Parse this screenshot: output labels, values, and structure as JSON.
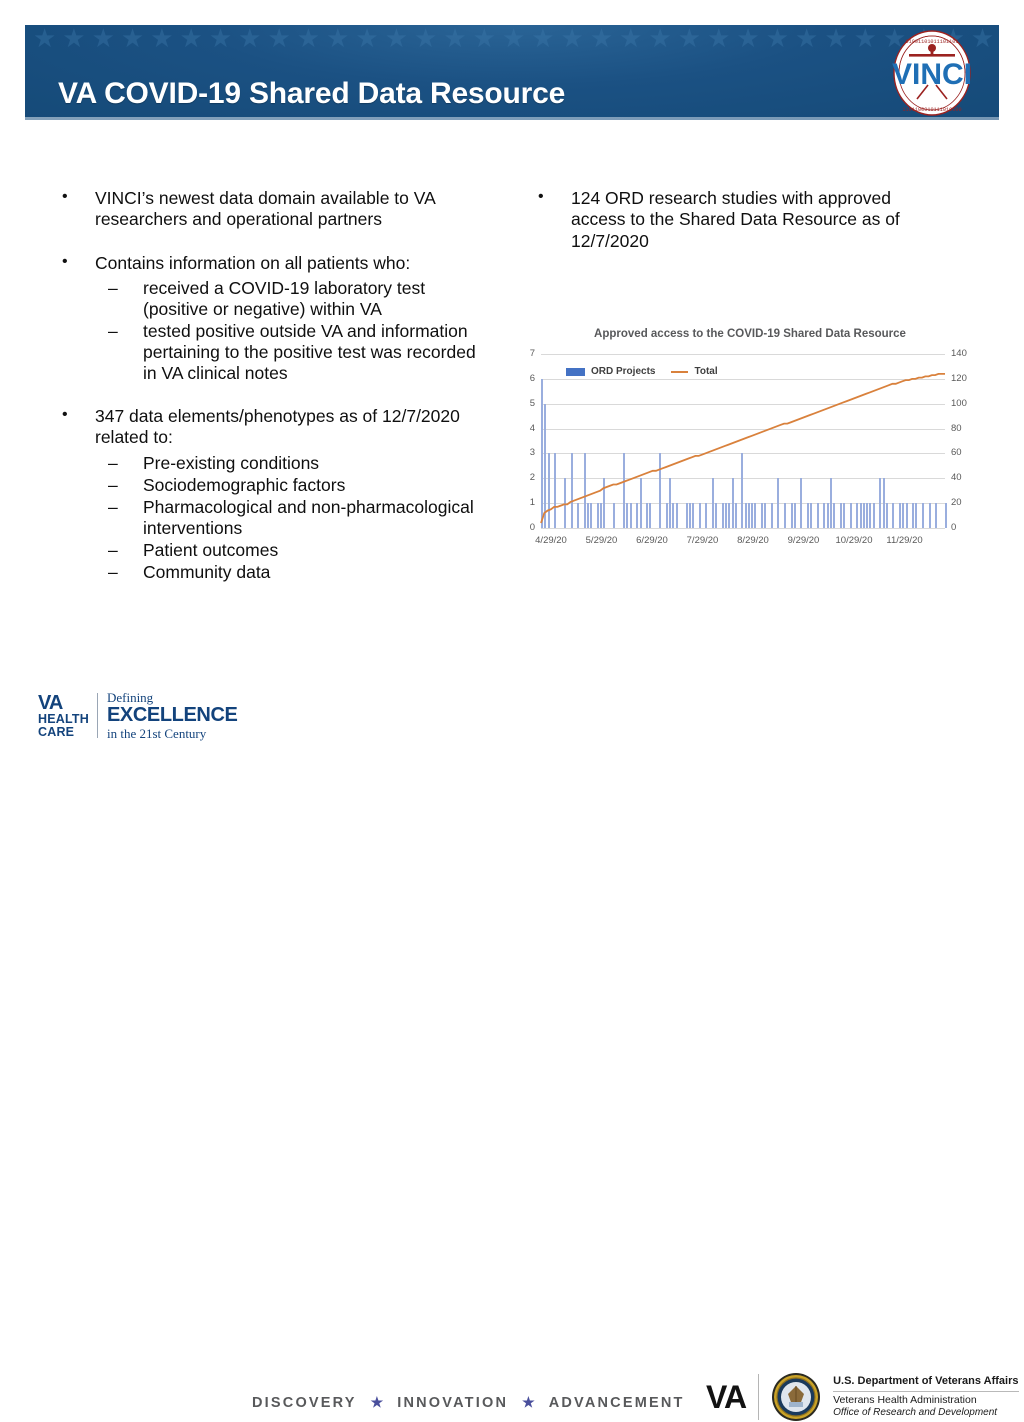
{
  "header": {
    "title": "VA COVID-19 Shared Data Resource",
    "logo_text": "VINCI",
    "logo_name": "vinci-logo",
    "banner_color": "#15507f",
    "star_glyph": "★★★★★★★★★★★★★★★★★★★★★★★★★★★★★★★★★★★★★★★★★★★★★★★★★★★★★★"
  },
  "left_column": {
    "bullets": [
      {
        "text": "VINCI’s newest data domain available to VA researchers and operational partners",
        "sub": []
      },
      {
        "text": "Contains information on all patients who:",
        "sub": [
          "received a COVID-19 laboratory test (positive or negative) within VA",
          "tested positive outside VA and information pertaining to the positive test was recorded in VA clinical notes"
        ]
      },
      {
        "text": "347 data elements/phenotypes as of 12/7/2020 related to:",
        "sub": [
          "Pre-existing conditions",
          "Sociodemographic factors",
          "Pharmacological and non-pharmacological interventions",
          "Patient outcomes",
          "Community data"
        ]
      }
    ]
  },
  "right_column": {
    "bullets": [
      {
        "text": "124 ORD research studies with approved access to the Shared Data Resource as of 12/7/2020",
        "sub": []
      }
    ]
  },
  "chart_data": {
    "type": "line",
    "title": "Approved access to the COVID-19 Shared Data Resource",
    "xlabel": "",
    "ylabel": "",
    "grid": true,
    "legend_position": "top-left",
    "bar_color": "#9aaede",
    "line_color": "#d9813c",
    "y_left": {
      "label": "ORD Projects",
      "ticks": [
        0,
        1,
        2,
        3,
        4,
        5,
        6,
        7
      ],
      "ylim": [
        0,
        7
      ]
    },
    "y_right": {
      "label": "Total",
      "ticks": [
        0,
        20,
        40,
        60,
        80,
        100,
        120,
        140
      ],
      "ylim": [
        0,
        140
      ]
    },
    "x_ticks": [
      "4/29/20",
      "5/29/20",
      "6/29/20",
      "7/29/20",
      "8/29/20",
      "9/29/20",
      "10/29/20",
      "11/29/20"
    ],
    "x_range": [
      "4/29/20",
      "12/7/20"
    ],
    "series": [
      {
        "name": "ORD Projects",
        "type": "bar",
        "axis": "left",
        "values": [
          6,
          5,
          3,
          0,
          3,
          0,
          0,
          2,
          0,
          3,
          0,
          1,
          0,
          3,
          1,
          1,
          0,
          1,
          1,
          2,
          0,
          0,
          1,
          0,
          0,
          3,
          1,
          1,
          0,
          1,
          2,
          0,
          1,
          1,
          0,
          0,
          3,
          0,
          1,
          2,
          1,
          1,
          0,
          0,
          1,
          1,
          1,
          0,
          1,
          0,
          1,
          0,
          2,
          1,
          0,
          1,
          1,
          1,
          2,
          1,
          0,
          3,
          1,
          1,
          1,
          1,
          0,
          1,
          1,
          0,
          1,
          0,
          2,
          0,
          1,
          0,
          1,
          1,
          0,
          2,
          0,
          1,
          1,
          0,
          1,
          0,
          1,
          1,
          2,
          1,
          0,
          1,
          1,
          0,
          1,
          0,
          1,
          1,
          1,
          1,
          1,
          1,
          0,
          2,
          2,
          1,
          0,
          1,
          0,
          1,
          1,
          1,
          0,
          1,
          1,
          0,
          1,
          0,
          1,
          0,
          1,
          0,
          0,
          1
        ]
      },
      {
        "name": "Total",
        "type": "line",
        "axis": "right",
        "values": [
          4,
          12,
          14,
          15,
          17,
          17,
          18,
          19,
          19,
          21,
          22,
          23,
          24,
          25,
          26,
          27,
          28,
          29,
          30,
          32,
          33,
          34,
          35,
          35,
          36,
          37,
          38,
          39,
          40,
          41,
          42,
          43,
          44,
          45,
          46,
          46,
          47,
          48,
          49,
          50,
          51,
          52,
          53,
          54,
          55,
          56,
          57,
          58,
          58,
          59,
          60,
          61,
          62,
          63,
          64,
          65,
          66,
          67,
          68,
          69,
          70,
          71,
          72,
          73,
          74,
          75,
          76,
          77,
          78,
          79,
          80,
          81,
          82,
          83,
          84,
          84,
          85,
          86,
          87,
          88,
          89,
          90,
          91,
          92,
          93,
          94,
          95,
          96,
          97,
          98,
          99,
          100,
          101,
          102,
          103,
          104,
          105,
          106,
          107,
          108,
          109,
          110,
          111,
          112,
          113,
          114,
          115,
          116,
          116,
          117,
          118,
          119,
          119,
          120,
          120,
          121,
          121,
          122,
          122,
          123,
          123,
          124,
          124,
          124
        ]
      }
    ],
    "legend": [
      "ORD Projects",
      "Total"
    ]
  },
  "footer": {
    "va_health_care": {
      "va": "VA",
      "health": "HEALTH",
      "care": "CARE",
      "defining": "Defining",
      "excellence": "EXCELLENCE",
      "century": "in the 21st Century"
    },
    "tagline": {
      "item1": "DISCOVERY",
      "star1": "★",
      "item2": "INNOVATION",
      "star2": "★",
      "item3": "ADVANCEMENT"
    },
    "va_dept": {
      "mark": "VA",
      "line1": "U.S. Department of Veterans Affairs",
      "line2": "Veterans Health Administration",
      "line3": "Office of Research and Development"
    }
  }
}
